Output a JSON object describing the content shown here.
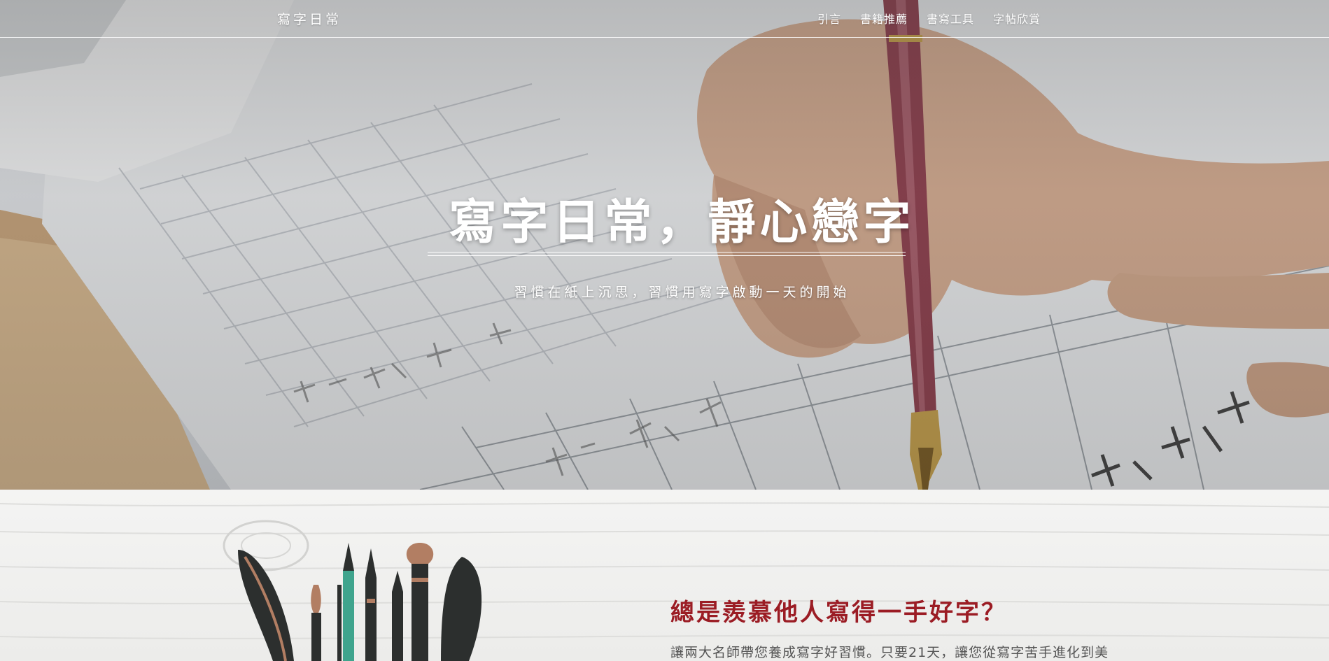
{
  "nav": {
    "brand": "寫字日常",
    "links": [
      "引言",
      "書籍推薦",
      "書寫工具",
      "字帖欣賞"
    ]
  },
  "hero": {
    "title": "寫字日常，靜心戀字",
    "subtitle": "習慣在紙上沉思，習慣用寫字啟動一天的開始"
  },
  "intro": {
    "heading": "總是羨慕他人寫得一手好字？",
    "text": "讓兩大名師帶您養成寫字好習慣。只要21天，讓您從寫字苦手進化到美"
  },
  "colors": {
    "accent": "#9b1c24",
    "nav_text": "#ffffff",
    "body_text": "#555555"
  },
  "icons": [
    "pens-illustration"
  ]
}
